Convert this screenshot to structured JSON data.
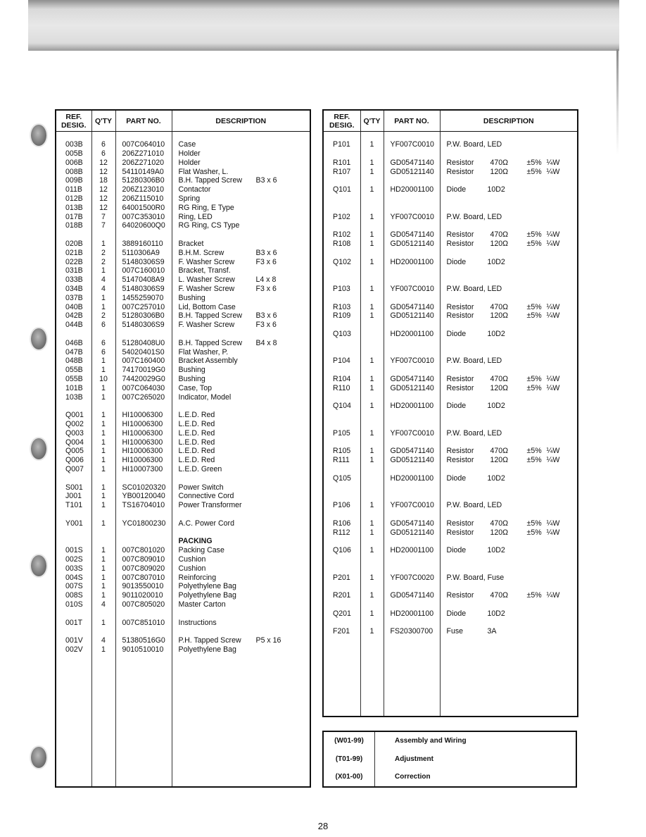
{
  "page_number": "28",
  "headers": {
    "ref_desig": "REF.\nDESIG.",
    "ref_line1": "REF.",
    "ref_line2": "DESIG.",
    "qty": "Q'TY",
    "part_no": "PART NO.",
    "description": "DESCRIPTION"
  },
  "left_table": {
    "rows": [
      {
        "type": "gap"
      },
      {
        "ref": "003B",
        "qty": "6",
        "part": "007C064010",
        "desc": "Case",
        "spec": ""
      },
      {
        "ref": "005B",
        "qty": "6",
        "part": "206Z271010",
        "desc": "Holder",
        "spec": ""
      },
      {
        "ref": "006B",
        "qty": "12",
        "part": "206Z271020",
        "desc": "Holder",
        "spec": ""
      },
      {
        "ref": "008B",
        "qty": "12",
        "part": "54110149A0",
        "desc": "Flat Washer, L.",
        "spec": ""
      },
      {
        "ref": "009B",
        "qty": "18",
        "part": "51280306B0",
        "desc": "B.H. Tapped Screw",
        "spec": "B3 x 6"
      },
      {
        "ref": "011B",
        "qty": "12",
        "part": "206Z123010",
        "desc": "Contactor",
        "spec": ""
      },
      {
        "ref": "012B",
        "qty": "12",
        "part": "206Z115010",
        "desc": "Spring",
        "spec": ""
      },
      {
        "ref": "013B",
        "qty": "12",
        "part": "64001500R0",
        "desc": "RG Ring, E Type",
        "spec": ""
      },
      {
        "ref": "017B",
        "qty": "7",
        "part": "007C353010",
        "desc": "Ring, LED",
        "spec": ""
      },
      {
        "ref": "018B",
        "qty": "7",
        "part": "64020600Q0",
        "desc": "RG Ring, CS Type",
        "spec": ""
      },
      {
        "type": "gap"
      },
      {
        "ref": "020B",
        "qty": "1",
        "part": "3889160110",
        "desc": "Bracket",
        "spec": ""
      },
      {
        "ref": "021B",
        "qty": "2",
        "part": "5110306A9",
        "desc": "B.H.M. Screw",
        "spec": "B3 x 6"
      },
      {
        "ref": "022B",
        "qty": "2",
        "part": "51480306S9",
        "desc": "F. Washer Screw",
        "spec": "F3 x 6"
      },
      {
        "ref": "031B",
        "qty": "1",
        "part": "007C160010",
        "desc": "Bracket, Transf.",
        "spec": ""
      },
      {
        "ref": "033B",
        "qty": "4",
        "part": "51470408A9",
        "desc": "L. Washer Screw",
        "spec": "L4 x 8"
      },
      {
        "ref": "034B",
        "qty": "4",
        "part": "51480306S9",
        "desc": "F. Washer Screw",
        "spec": "F3 x 6"
      },
      {
        "ref": "037B",
        "qty": "1",
        "part": "1455259070",
        "desc": "Bushing",
        "spec": ""
      },
      {
        "ref": "040B",
        "qty": "1",
        "part": "007C257010",
        "desc": "Lid, Bottom Case",
        "spec": ""
      },
      {
        "ref": "042B",
        "qty": "2",
        "part": "51280306B0",
        "desc": "B.H. Tapped Screw",
        "spec": "B3 x 6"
      },
      {
        "ref": "044B",
        "qty": "6",
        "part": "51480306S9",
        "desc": "F. Washer Screw",
        "spec": "F3 x 6"
      },
      {
        "type": "gap"
      },
      {
        "ref": "046B",
        "qty": "6",
        "part": "51280408U0",
        "desc": "B.H. Tapped Screw",
        "spec": "B4 x 8"
      },
      {
        "ref": "047B",
        "qty": "6",
        "part": "54020401S0",
        "desc": "Flat Washer, P.",
        "spec": ""
      },
      {
        "ref": "048B",
        "qty": "1",
        "part": "007C160400",
        "desc": "Bracket Assembly",
        "spec": ""
      },
      {
        "ref": "055B",
        "qty": "1",
        "part": "74170019G0",
        "desc": "Bushing",
        "spec": ""
      },
      {
        "ref": "055B",
        "qty": "10",
        "part": "74420029G0",
        "desc": "Bushing",
        "spec": ""
      },
      {
        "ref": "101B",
        "qty": "1",
        "part": "007C064030",
        "desc": "Case, Top",
        "spec": ""
      },
      {
        "ref": "103B",
        "qty": "1",
        "part": "007C265020",
        "desc": "Indicator, Model",
        "spec": ""
      },
      {
        "type": "gap"
      },
      {
        "ref": "Q001",
        "qty": "1",
        "part": "HI10006300",
        "desc": "L.E.D. Red",
        "spec": ""
      },
      {
        "ref": "Q002",
        "qty": "1",
        "part": "HI10006300",
        "desc": "L.E.D. Red",
        "spec": ""
      },
      {
        "ref": "Q003",
        "qty": "1",
        "part": "HI10006300",
        "desc": "L.E.D. Red",
        "spec": ""
      },
      {
        "ref": "Q004",
        "qty": "1",
        "part": "HI10006300",
        "desc": "L.E.D. Red",
        "spec": ""
      },
      {
        "ref": "Q005",
        "qty": "1",
        "part": "HI10006300",
        "desc": "L.E.D. Red",
        "spec": ""
      },
      {
        "ref": "Q006",
        "qty": "1",
        "part": "HI10006300",
        "desc": "L.E.D. Red",
        "spec": ""
      },
      {
        "ref": "Q007",
        "qty": "1",
        "part": "HI10007300",
        "desc": "L.E.D. Green",
        "spec": ""
      },
      {
        "type": "gap"
      },
      {
        "ref": "S001",
        "qty": "1",
        "part": "SC01020320",
        "desc": "Power Switch",
        "spec": ""
      },
      {
        "ref": "J001",
        "qty": "1",
        "part": "YB00120040",
        "desc": "Connective Cord",
        "spec": ""
      },
      {
        "ref": "T101",
        "qty": "1",
        "part": "TS16704010",
        "desc": "Power Transformer",
        "spec": ""
      },
      {
        "type": "gap"
      },
      {
        "ref": "Y001",
        "qty": "1",
        "part": "YC01800230",
        "desc": "A.C. Power Cord",
        "spec": ""
      },
      {
        "type": "gap"
      },
      {
        "type": "section",
        "desc": "PACKING"
      },
      {
        "ref": "001S",
        "qty": "1",
        "part": "007C801020",
        "desc": "Packing Case",
        "spec": ""
      },
      {
        "ref": "002S",
        "qty": "1",
        "part": "007C809010",
        "desc": "Cushion",
        "spec": ""
      },
      {
        "ref": "003S",
        "qty": "1",
        "part": "007C809020",
        "desc": "Cushion",
        "spec": ""
      },
      {
        "ref": "004S",
        "qty": "1",
        "part": "007C807010",
        "desc": "Reinforcing",
        "spec": ""
      },
      {
        "ref": "007S",
        "qty": "1",
        "part": "9013550010",
        "desc": "Polyethylene Bag",
        "spec": ""
      },
      {
        "ref": "008S",
        "qty": "1",
        "part": "9011020010",
        "desc": "Polyethylene Bag",
        "spec": ""
      },
      {
        "ref": "010S",
        "qty": "4",
        "part": "007C805020",
        "desc": "Master Carton",
        "spec": ""
      },
      {
        "type": "gap"
      },
      {
        "ref": "001T",
        "qty": "1",
        "part": "007C851010",
        "desc": "Instructions",
        "spec": ""
      },
      {
        "type": "gap"
      },
      {
        "ref": "001V",
        "qty": "4",
        "part": "51380516G0",
        "desc": "P.H. Tapped Screw",
        "spec": "P5 x 16"
      },
      {
        "ref": "002V",
        "qty": "1",
        "part": "9010510010",
        "desc": "Polyethylene Bag",
        "spec": ""
      }
    ]
  },
  "right_table": {
    "rows": [
      {
        "type": "gap"
      },
      {
        "ref": "P101",
        "qty": "1",
        "part": "YF007C0010",
        "desc": "P.W. Board, LED"
      },
      {
        "type": "gap"
      },
      {
        "ref": "R101",
        "qty": "1",
        "part": "GD05471140",
        "desc": "Resistor",
        "value": "470Ω",
        "tol": "±5%",
        "watt": "¼W"
      },
      {
        "ref": "R107",
        "qty": "1",
        "part": "GD05121140",
        "desc": "Resistor",
        "value": "120Ω",
        "tol": "±5%",
        "watt": "¼W"
      },
      {
        "type": "gap"
      },
      {
        "ref": "Q101",
        "qty": "1",
        "part": "HD20001100",
        "desc": "Diode",
        "value": "10D2"
      },
      {
        "type": "gap"
      },
      {
        "type": "gap"
      },
      {
        "ref": "P102",
        "qty": "1",
        "part": "YF007C0010",
        "desc": "P.W. Board, LED"
      },
      {
        "type": "gap"
      },
      {
        "ref": "R102",
        "qty": "1",
        "part": "GD05471140",
        "desc": "Resistor",
        "value": "470Ω",
        "tol": "±5%",
        "watt": "¼W"
      },
      {
        "ref": "R108",
        "qty": "1",
        "part": "GD05121140",
        "desc": "Resistor",
        "value": "120Ω",
        "tol": "±5%",
        "watt": "¼W"
      },
      {
        "type": "gap"
      },
      {
        "ref": "Q102",
        "qty": "1",
        "part": "HD20001100",
        "desc": "Diode",
        "value": "10D2"
      },
      {
        "type": "gap"
      },
      {
        "type": "gap"
      },
      {
        "ref": "P103",
        "qty": "1",
        "part": "YF007C0010",
        "desc": "P.W. Board, LED"
      },
      {
        "type": "gap"
      },
      {
        "ref": "R103",
        "qty": "1",
        "part": "GD05471140",
        "desc": "Resistor",
        "value": "470Ω",
        "tol": "±5%",
        "watt": "¼W"
      },
      {
        "ref": "R109",
        "qty": "1",
        "part": "GD05121140",
        "desc": "Resistor",
        "value": "120Ω",
        "tol": "±5%",
        "watt": "¼W"
      },
      {
        "type": "gap"
      },
      {
        "ref": "Q103",
        "qty": "",
        "part": "HD20001100",
        "desc": "Diode",
        "value": "10D2"
      },
      {
        "type": "gap"
      },
      {
        "type": "gap"
      },
      {
        "ref": "P104",
        "qty": "1",
        "part": "YF007C0010",
        "desc": "P.W. Board, LED"
      },
      {
        "type": "gap"
      },
      {
        "ref": "R104",
        "qty": "1",
        "part": "GD05471140",
        "desc": "Resistor",
        "value": "470Ω",
        "tol": "±5%",
        "watt": "¼W"
      },
      {
        "ref": "R110",
        "qty": "1",
        "part": "GD05121140",
        "desc": "Resistor",
        "value": "120Ω",
        "tol": "±5%",
        "watt": "¼W"
      },
      {
        "type": "gap"
      },
      {
        "ref": "Q104",
        "qty": "1",
        "part": "HD20001100",
        "desc": "Diode",
        "value": "10D2"
      },
      {
        "type": "gap"
      },
      {
        "type": "gap"
      },
      {
        "ref": "P105",
        "qty": "1",
        "part": "YF007C0010",
        "desc": "P.W. Board, LED"
      },
      {
        "type": "gap"
      },
      {
        "ref": "R105",
        "qty": "1",
        "part": "GD05471140",
        "desc": "Resistor",
        "value": "470Ω",
        "tol": "±5%",
        "watt": "¼W"
      },
      {
        "ref": "R111",
        "qty": "1",
        "part": "GD05121140",
        "desc": "Resistor",
        "value": "120Ω",
        "tol": "±5%",
        "watt": "¼W"
      },
      {
        "type": "gap"
      },
      {
        "ref": "Q105",
        "qty": "",
        "part": "HD20001100",
        "desc": "Diode",
        "value": "10D2"
      },
      {
        "type": "gap"
      },
      {
        "type": "gap"
      },
      {
        "ref": "P106",
        "qty": "1",
        "part": "YF007C0010",
        "desc": "P.W. Board, LED"
      },
      {
        "type": "gap"
      },
      {
        "ref": "R106",
        "qty": "1",
        "part": "GD05471140",
        "desc": "Resistor",
        "value": "470Ω",
        "tol": "±5%",
        "watt": "¼W"
      },
      {
        "ref": "R112",
        "qty": "1",
        "part": "GD05121140",
        "desc": "Resistor",
        "value": "120Ω",
        "tol": "±5%",
        "watt": "¼W"
      },
      {
        "type": "gap"
      },
      {
        "ref": "Q106",
        "qty": "1",
        "part": "HD20001100",
        "desc": "Diode",
        "value": "10D2"
      },
      {
        "type": "gap"
      },
      {
        "type": "gap"
      },
      {
        "ref": "P201",
        "qty": "1",
        "part": "YF007C0020",
        "desc": "P.W. Board, Fuse"
      },
      {
        "type": "gap"
      },
      {
        "ref": "R201",
        "qty": "1",
        "part": "GD05471140",
        "desc": "Resistor",
        "value": "470Ω",
        "tol": "±5%",
        "watt": "¼W"
      },
      {
        "type": "gap"
      },
      {
        "ref": "Q201",
        "qty": "1",
        "part": "HD20001100",
        "desc": "Diode",
        "value": "10D2"
      },
      {
        "type": "gap"
      },
      {
        "ref": "F201",
        "qty": "1",
        "part": "FS20300700",
        "desc": "Fuse",
        "value": "3A"
      }
    ]
  },
  "legend": [
    {
      "code": "(W01-99)",
      "label": "Assembly and Wiring"
    },
    {
      "code": "(T01-99)",
      "label": "Adjustment"
    },
    {
      "code": "(X01-00)",
      "label": "Correction"
    }
  ]
}
